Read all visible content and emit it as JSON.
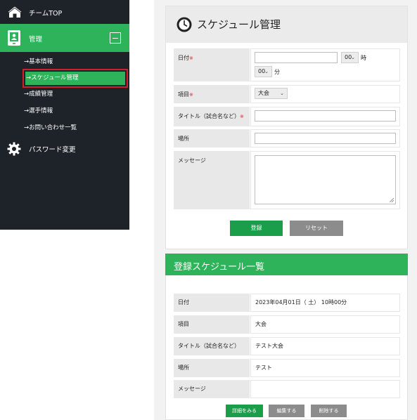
{
  "sidebar": {
    "team_top": "チームTOP",
    "admin": "管理",
    "items": [
      {
        "label": "→基本情報"
      },
      {
        "label": "→スケジュール管理"
      },
      {
        "label": "→成績管理"
      },
      {
        "label": "→選手情報"
      },
      {
        "label": "→お問い合わせ一覧"
      }
    ],
    "password": "パスワード変更"
  },
  "form": {
    "title": "スケジュール管理",
    "required_mark": "※",
    "date_label": "日付",
    "hour_value": "00",
    "hour_unit": "時",
    "minute_value": "00",
    "minute_unit": "分",
    "item_label": "項目",
    "item_value": "大会",
    "title_label": "タイトル（試合名など）",
    "place_label": "場所",
    "message_label": "メッセージ",
    "submit": "登録",
    "reset": "リセット"
  },
  "list": {
    "heading": "登録スケジュール一覧",
    "rows": [
      {
        "label": "日付",
        "value": "2023年04月01日（ 土） 10時00分"
      },
      {
        "label": "項目",
        "value": "大会"
      },
      {
        "label": "タイトル（試合名など）",
        "value": "テスト大会"
      },
      {
        "label": "場所",
        "value": "テスト"
      },
      {
        "label": "メッセージ",
        "value": ""
      }
    ],
    "detail_btn": "詳細をみる",
    "edit_btn": "編集する",
    "delete_btn": "削除する"
  },
  "colors": {
    "accent": "#2fb35a",
    "sidebar": "#1e2229",
    "highlight_border": "#d2202a"
  }
}
